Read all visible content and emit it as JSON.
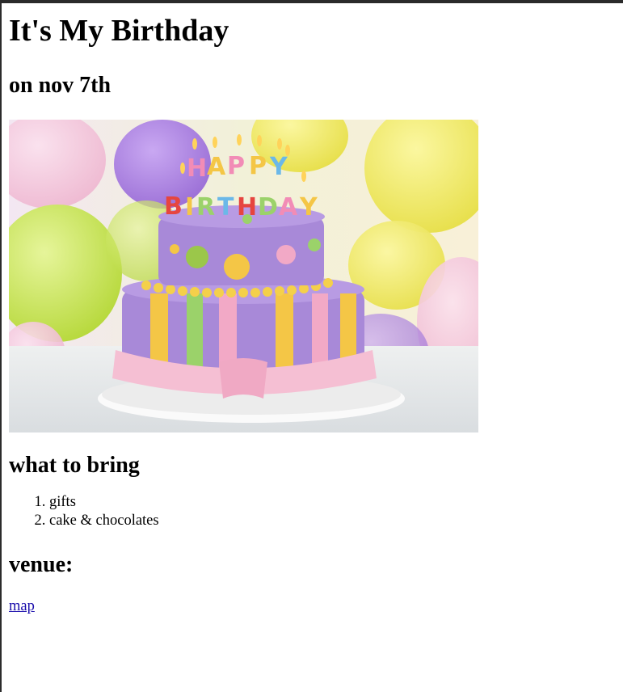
{
  "page": {
    "title": "It's My Birthday",
    "date_heading": "on nov 7th",
    "bring_heading": "what to bring",
    "bring_items": [
      "gifts",
      "cake & chocolates"
    ],
    "venue_heading": "venue:",
    "map_link": "map"
  },
  "image": {
    "name": "birthday-cake-image",
    "candle_letters_top": "HAPPY",
    "candle_letters_bottom": "BIRTHDAY"
  },
  "colors": {
    "link": "#1a0dab",
    "frame": "#2b2b2b"
  }
}
